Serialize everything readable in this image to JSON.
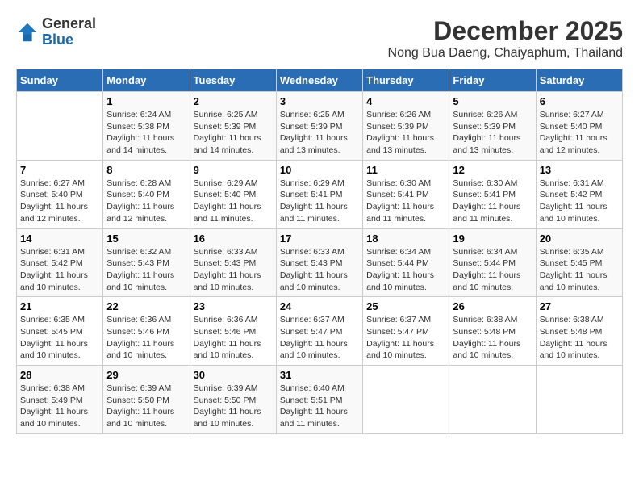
{
  "logo": {
    "general": "General",
    "blue": "Blue"
  },
  "title": "December 2025",
  "subtitle": "Nong Bua Daeng, Chaiyaphum, Thailand",
  "days_of_week": [
    "Sunday",
    "Monday",
    "Tuesday",
    "Wednesday",
    "Thursday",
    "Friday",
    "Saturday"
  ],
  "weeks": [
    [
      {
        "day": "",
        "content": ""
      },
      {
        "day": "1",
        "content": "Sunrise: 6:24 AM\nSunset: 5:38 PM\nDaylight: 11 hours\nand 14 minutes."
      },
      {
        "day": "2",
        "content": "Sunrise: 6:25 AM\nSunset: 5:39 PM\nDaylight: 11 hours\nand 14 minutes."
      },
      {
        "day": "3",
        "content": "Sunrise: 6:25 AM\nSunset: 5:39 PM\nDaylight: 11 hours\nand 13 minutes."
      },
      {
        "day": "4",
        "content": "Sunrise: 6:26 AM\nSunset: 5:39 PM\nDaylight: 11 hours\nand 13 minutes."
      },
      {
        "day": "5",
        "content": "Sunrise: 6:26 AM\nSunset: 5:39 PM\nDaylight: 11 hours\nand 13 minutes."
      },
      {
        "day": "6",
        "content": "Sunrise: 6:27 AM\nSunset: 5:40 PM\nDaylight: 11 hours\nand 12 minutes."
      }
    ],
    [
      {
        "day": "7",
        "content": "Sunrise: 6:27 AM\nSunset: 5:40 PM\nDaylight: 11 hours\nand 12 minutes."
      },
      {
        "day": "8",
        "content": "Sunrise: 6:28 AM\nSunset: 5:40 PM\nDaylight: 11 hours\nand 12 minutes."
      },
      {
        "day": "9",
        "content": "Sunrise: 6:29 AM\nSunset: 5:40 PM\nDaylight: 11 hours\nand 11 minutes."
      },
      {
        "day": "10",
        "content": "Sunrise: 6:29 AM\nSunset: 5:41 PM\nDaylight: 11 hours\nand 11 minutes."
      },
      {
        "day": "11",
        "content": "Sunrise: 6:30 AM\nSunset: 5:41 PM\nDaylight: 11 hours\nand 11 minutes."
      },
      {
        "day": "12",
        "content": "Sunrise: 6:30 AM\nSunset: 5:41 PM\nDaylight: 11 hours\nand 11 minutes."
      },
      {
        "day": "13",
        "content": "Sunrise: 6:31 AM\nSunset: 5:42 PM\nDaylight: 11 hours\nand 10 minutes."
      }
    ],
    [
      {
        "day": "14",
        "content": "Sunrise: 6:31 AM\nSunset: 5:42 PM\nDaylight: 11 hours\nand 10 minutes."
      },
      {
        "day": "15",
        "content": "Sunrise: 6:32 AM\nSunset: 5:43 PM\nDaylight: 11 hours\nand 10 minutes."
      },
      {
        "day": "16",
        "content": "Sunrise: 6:33 AM\nSunset: 5:43 PM\nDaylight: 11 hours\nand 10 minutes."
      },
      {
        "day": "17",
        "content": "Sunrise: 6:33 AM\nSunset: 5:43 PM\nDaylight: 11 hours\nand 10 minutes."
      },
      {
        "day": "18",
        "content": "Sunrise: 6:34 AM\nSunset: 5:44 PM\nDaylight: 11 hours\nand 10 minutes."
      },
      {
        "day": "19",
        "content": "Sunrise: 6:34 AM\nSunset: 5:44 PM\nDaylight: 11 hours\nand 10 minutes."
      },
      {
        "day": "20",
        "content": "Sunrise: 6:35 AM\nSunset: 5:45 PM\nDaylight: 11 hours\nand 10 minutes."
      }
    ],
    [
      {
        "day": "21",
        "content": "Sunrise: 6:35 AM\nSunset: 5:45 PM\nDaylight: 11 hours\nand 10 minutes."
      },
      {
        "day": "22",
        "content": "Sunrise: 6:36 AM\nSunset: 5:46 PM\nDaylight: 11 hours\nand 10 minutes."
      },
      {
        "day": "23",
        "content": "Sunrise: 6:36 AM\nSunset: 5:46 PM\nDaylight: 11 hours\nand 10 minutes."
      },
      {
        "day": "24",
        "content": "Sunrise: 6:37 AM\nSunset: 5:47 PM\nDaylight: 11 hours\nand 10 minutes."
      },
      {
        "day": "25",
        "content": "Sunrise: 6:37 AM\nSunset: 5:47 PM\nDaylight: 11 hours\nand 10 minutes."
      },
      {
        "day": "26",
        "content": "Sunrise: 6:38 AM\nSunset: 5:48 PM\nDaylight: 11 hours\nand 10 minutes."
      },
      {
        "day": "27",
        "content": "Sunrise: 6:38 AM\nSunset: 5:48 PM\nDaylight: 11 hours\nand 10 minutes."
      }
    ],
    [
      {
        "day": "28",
        "content": "Sunrise: 6:38 AM\nSunset: 5:49 PM\nDaylight: 11 hours\nand 10 minutes."
      },
      {
        "day": "29",
        "content": "Sunrise: 6:39 AM\nSunset: 5:50 PM\nDaylight: 11 hours\nand 10 minutes."
      },
      {
        "day": "30",
        "content": "Sunrise: 6:39 AM\nSunset: 5:50 PM\nDaylight: 11 hours\nand 10 minutes."
      },
      {
        "day": "31",
        "content": "Sunrise: 6:40 AM\nSunset: 5:51 PM\nDaylight: 11 hours\nand 11 minutes."
      },
      {
        "day": "",
        "content": ""
      },
      {
        "day": "",
        "content": ""
      },
      {
        "day": "",
        "content": ""
      }
    ]
  ]
}
